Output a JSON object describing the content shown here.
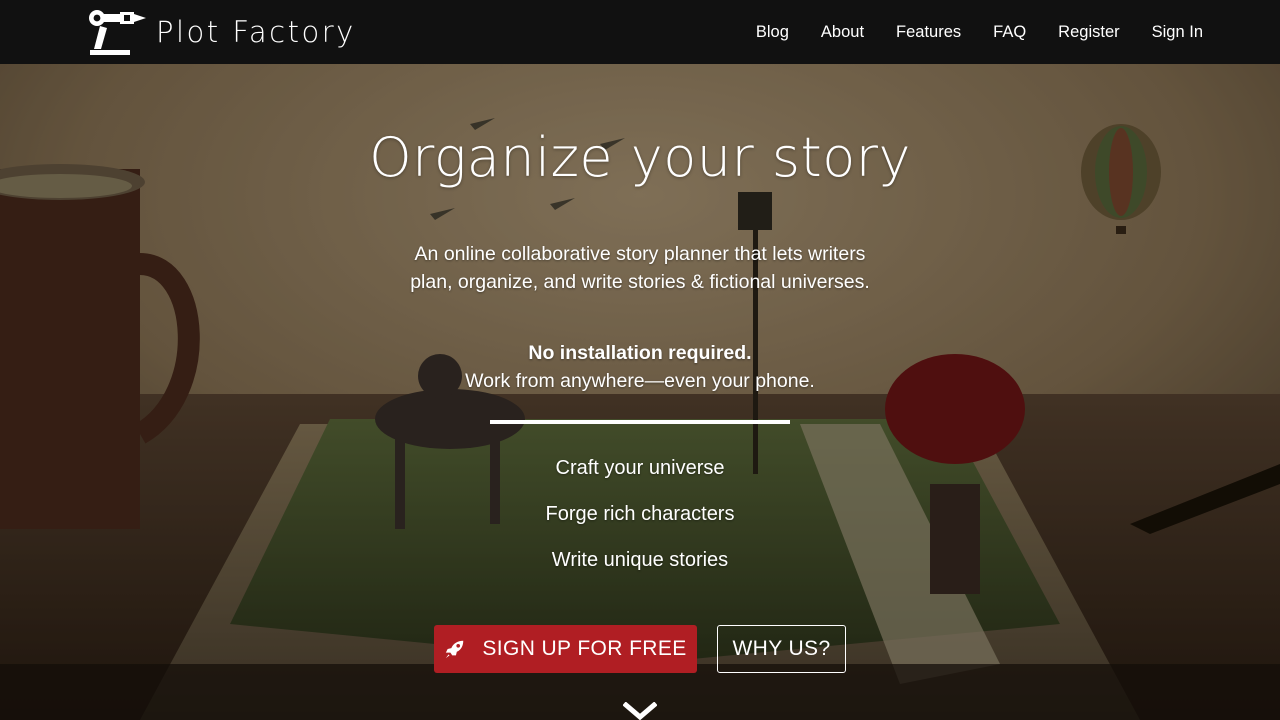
{
  "brand": {
    "name": "Plot Factory"
  },
  "nav": {
    "links": [
      "Blog",
      "About",
      "Features",
      "FAQ",
      "Register",
      "Sign In"
    ]
  },
  "hero": {
    "title": "Organize your story",
    "description": "An online collaborative story planner that lets writers plan, organize, and write stories & fictional universes.",
    "highlight": "No installation required.",
    "subline": "Work from anywhere—even your phone.",
    "features": [
      "Craft your universe",
      "Forge rich characters",
      "Write unique stories"
    ],
    "signup_label": "SIGN UP FOR FREE",
    "why_label": "WHY US?"
  },
  "icons": {
    "logo": "robot-arm-pen-icon",
    "signup": "rocket-icon",
    "scroll": "chevron-down-icon"
  },
  "colors": {
    "navbar": "#111111",
    "accent": "#b01e23",
    "text": "#ffffff"
  }
}
